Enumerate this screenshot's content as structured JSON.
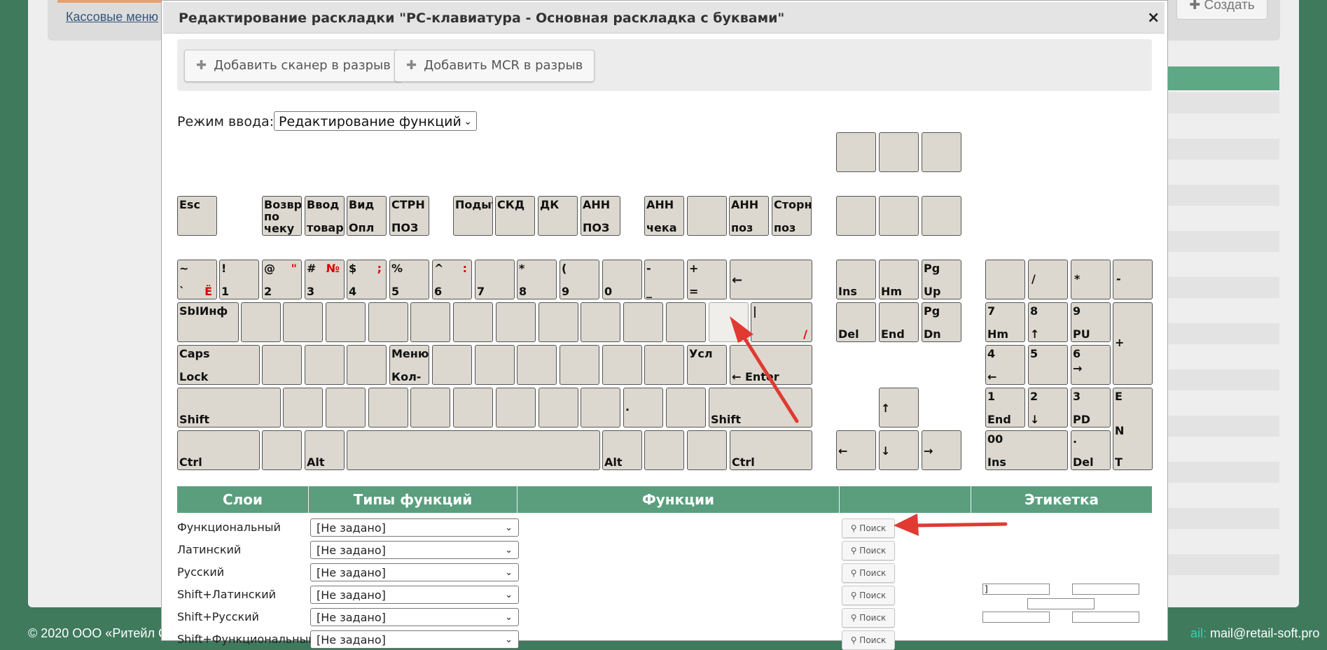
{
  "background": {
    "link_text": "Кассовые меню",
    "create_label": "Создать",
    "footer_left": "© 2020 ООО «Ритейл С",
    "footer_right_prefix": "ail:",
    "footer_right_email": "mail@retail-soft.pro"
  },
  "dialog": {
    "title": "Редактирование раскладки \"PC-клавиатура - Основная раскладка с буквами\"",
    "close": "×",
    "toolbar": {
      "add_scanner": "Добавить сканер в разрыв",
      "add_mcr": "Добавить MCR в разрыв"
    },
    "mode_label": "Режим ввода:",
    "mode_value": "Редактирование функций"
  },
  "keyboard": {
    "esc": "Esc",
    "fkeys": [
      {
        "t": "Возвр\nпо\nчеку",
        "b": ""
      },
      {
        "t": "Ввод",
        "b": "товара"
      },
      {
        "t": "Вид",
        "b": "Опл"
      },
      {
        "t": "СТРН",
        "b": "ПОЗ"
      },
      {
        "t": "Подыт",
        "b": ""
      },
      {
        "t": "СКД",
        "b": ""
      },
      {
        "t": "ДК",
        "b": ""
      },
      {
        "t": "АНН",
        "b": "ПОЗ"
      },
      {
        "t": "АНН",
        "b": "чека"
      },
      {
        "t": "",
        "b": ""
      },
      {
        "t": "АНН",
        "b": "поз"
      },
      {
        "t": "Сторн",
        "b": "поз"
      }
    ],
    "num_row": [
      {
        "t": "~",
        "b": "`",
        "rb": "Ё"
      },
      {
        "t": "!",
        "b": "1"
      },
      {
        "t": "@",
        "b": "2",
        "r": "\""
      },
      {
        "t": "#",
        "b": "3",
        "r": "№"
      },
      {
        "t": "$",
        "b": "4",
        "r": ";"
      },
      {
        "t": "%",
        "b": "5"
      },
      {
        "t": "^",
        "b": "6",
        "r": ":"
      },
      {
        "t": "",
        "b": "7"
      },
      {
        "t": "*",
        "b": "8"
      },
      {
        "t": "(",
        "b": "9"
      },
      {
        "t": "",
        "b": "0"
      },
      {
        "t": "-",
        "b": "_"
      },
      {
        "t": "+",
        "b": "="
      }
    ],
    "backspace": "←",
    "tab": "SbIИнф",
    "backslash_top": "|",
    "backslash_red": "/",
    "caps_top": "Caps",
    "caps_bottom": "Lock",
    "menu_top": "Меню",
    "menu_bottom": "Кол-",
    "usl": "Усл",
    "enter": "← Enter",
    "shift": "Shift",
    "period": ".",
    "ctrl": "Ctrl",
    "alt": "Alt",
    "nav": {
      "ins": "Ins",
      "hm": "Hm",
      "pgup_t": "Pg",
      "pgup_b": "Up",
      "del": "Del",
      "end": "End",
      "pgdn_t": "Pg",
      "pgdn_b": "Dn",
      "up": "↑",
      "left": "←",
      "down": "↓",
      "right": "→"
    },
    "numpad": {
      "slash": "/",
      "star": "*",
      "minus": "-",
      "plus": "+",
      "n7_t": "7",
      "n7_b": "Hm",
      "n8_t": "8",
      "n8_b": "↑",
      "n9_t": "9",
      "n9_b": "PU",
      "n4_t": "4",
      "n4_b": "←",
      "n5_t": "5",
      "n6_t": "6",
      "n6_b": "→",
      "n1_t": "1",
      "n1_b": "End",
      "n2_t": "2",
      "n2_b": "↓",
      "n3_t": "3",
      "n3_b": "PD",
      "n0_t": "00",
      "n0_b": "Ins",
      "dot_t": ".",
      "dot_b": "Del",
      "enter_1": "E",
      "enter_2": "N",
      "enter_3": "T"
    }
  },
  "table": {
    "headers": [
      "Слои",
      "Типы функций",
      "Функции",
      "",
      "Этикетка"
    ],
    "rows": [
      {
        "label": "Функциональный",
        "type": "[Не задано]",
        "search": "Поиск"
      },
      {
        "label": "Латинский",
        "type": "[Не задано]",
        "search": "Поиск"
      },
      {
        "label": "Русский",
        "type": "[Не задано]",
        "search": "Поиск"
      },
      {
        "label": "Shift+Латинский",
        "type": "[Не задано]",
        "search": "Поиск"
      },
      {
        "label": "Shift+Русский",
        "type": "[Не задано]",
        "search": "Поиск"
      },
      {
        "label": "Shift+Функциональный",
        "type": "[Не задано]",
        "search": "Поиск"
      }
    ],
    "label_first_value": "]"
  },
  "colors": {
    "page_bg": "#3f7a5d",
    "header_green": "#5a9e7e",
    "key_fill": "#dcd8cf",
    "arrow_red": "#e03a32"
  }
}
